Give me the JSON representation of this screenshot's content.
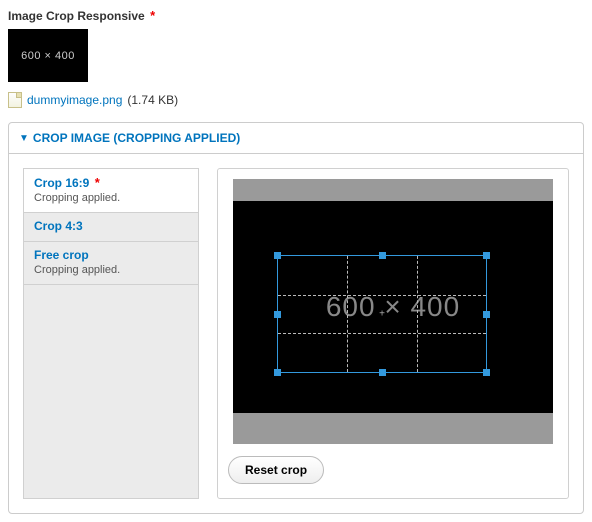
{
  "field": {
    "label": "Image Crop Responsive",
    "required_marker": "*"
  },
  "thumb": {
    "text": "600 × 400"
  },
  "file": {
    "name": "dummyimage.png",
    "size": "(1.74 KB)"
  },
  "panel": {
    "disclosure": "▼",
    "title": "CROP IMAGE (CROPPING APPLIED)"
  },
  "tabs": [
    {
      "label": "Crop 16:9",
      "required": true,
      "status": "Cropping applied."
    },
    {
      "label": "Crop 4:3",
      "required": false,
      "status": ""
    },
    {
      "label": "Free crop",
      "required": false,
      "status": "Cropping applied."
    }
  ],
  "crop": {
    "image_text": "600 × 400",
    "center_mark": "+",
    "reset_label": "Reset crop"
  }
}
